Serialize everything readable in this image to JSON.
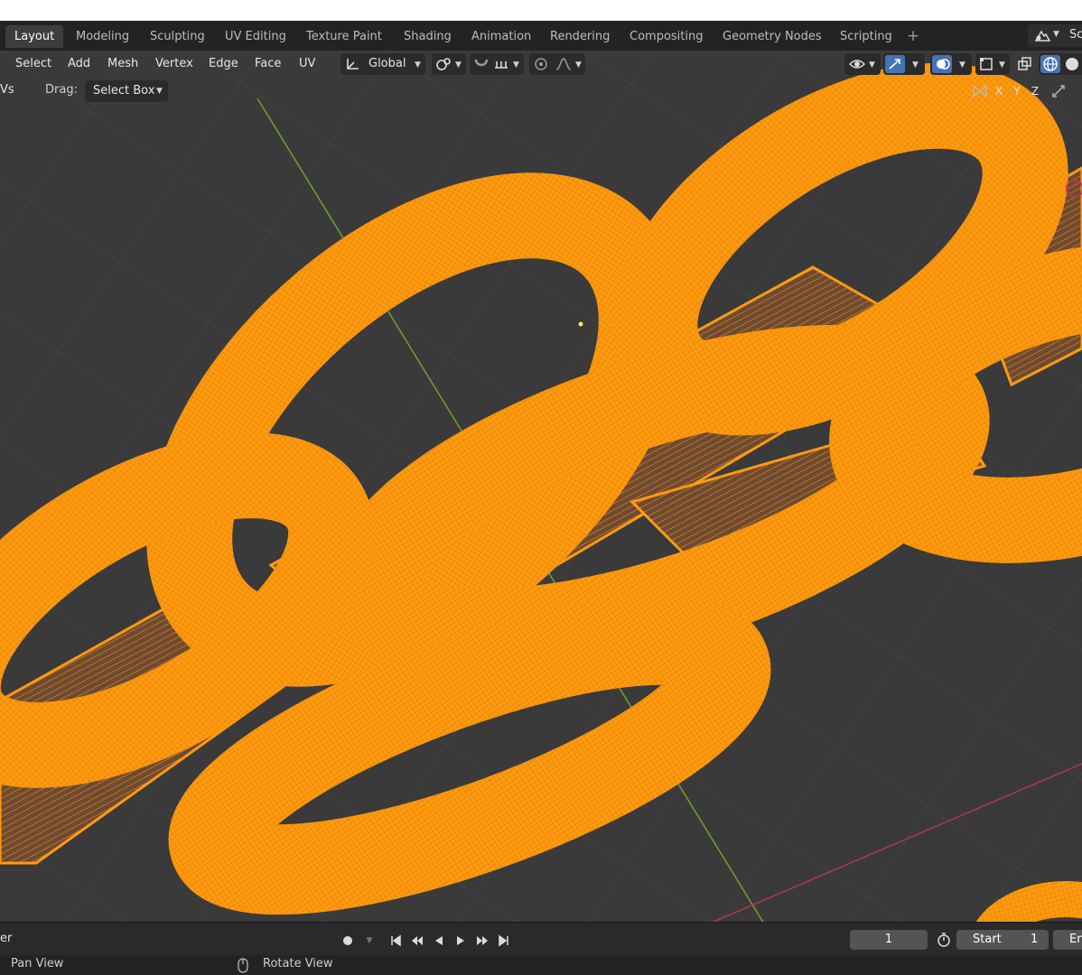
{
  "workspace_tabs": [
    "Layout",
    "Modeling",
    "Sculpting",
    "UV Editing",
    "Texture Paint",
    "Shading",
    "Animation",
    "Rendering",
    "Compositing",
    "Geometry Nodes",
    "Scripting"
  ],
  "scene_label": "Sc",
  "menu": {
    "select": "Select",
    "add": "Add",
    "mesh": "Mesh",
    "vertex": "Vertex",
    "edge": "Edge",
    "face": "Face",
    "uv": "UV"
  },
  "transform_orientation": "Global",
  "tool_settings": {
    "vs_label": "Vs",
    "drag_label": "Drag:",
    "drag_value": "Select Box"
  },
  "mirror_axes": [
    "X",
    "Y",
    "Z"
  ],
  "timeline": {
    "left_label": "er",
    "current_frame": "1",
    "start_label": "Start",
    "start_value": "1",
    "end_label": "En"
  },
  "status": {
    "pan": "Pan View",
    "rotate": "Rotate View"
  },
  "colors": {
    "mesh": "#ff9a0f",
    "mesh_fill": "#6e4a32",
    "bg": "#3a3a3a",
    "grid": "#444444",
    "y_axis": "#6f9a2b",
    "x_axis": "#a93a4a",
    "header": "#232323"
  }
}
